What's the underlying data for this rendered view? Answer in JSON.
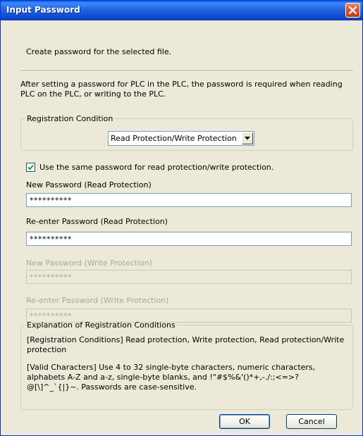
{
  "dialog": {
    "title": "Input Password",
    "intro": "Create password for the selected file.",
    "description": "After setting a password for PLC in the PLC, the password is required when reading PLC on the PLC, or writing to the PLC."
  },
  "registration": {
    "group_label": "Registration Condition",
    "selected": "Read Protection/Write Protection"
  },
  "same_password": {
    "checked": true,
    "label": "Use the same password for read protection/write protection."
  },
  "fields": {
    "new_read": {
      "label": "New Password (Read Protection)",
      "value": "**********"
    },
    "reenter_read": {
      "label": "Re-enter Password (Read Protection)",
      "value": "**********"
    },
    "new_write": {
      "label": "New Password (Write Protection)",
      "value": "**********"
    },
    "reenter_write": {
      "label": "Re-enter Password (Write Protection)",
      "value": "**********"
    }
  },
  "explanation": {
    "group_label": "Explanation of Registration Conditions",
    "conditions": "[Registration Conditions] Read protection, Write protection, Read protection/Write protection",
    "valid_chars": "[Valid Characters] Use 4 to 32 single-byte characters, numeric characters, alphabets A-Z and a-z, single-byte blanks, and !\"#$%&'()*+,-./:;<=>?@[\\]^_`{|}~. Passwords are case-sensitive."
  },
  "buttons": {
    "ok": "OK",
    "cancel": "Cancel"
  },
  "colors": {
    "titlebar": "#0b49d1",
    "dialog_bg": "#ece9d8",
    "close": "#d9532d",
    "disabled_text": "#aca899"
  },
  "icons": {
    "close": "close-x-icon",
    "dropdown": "chevron-down-icon",
    "check": "checkmark-icon"
  }
}
